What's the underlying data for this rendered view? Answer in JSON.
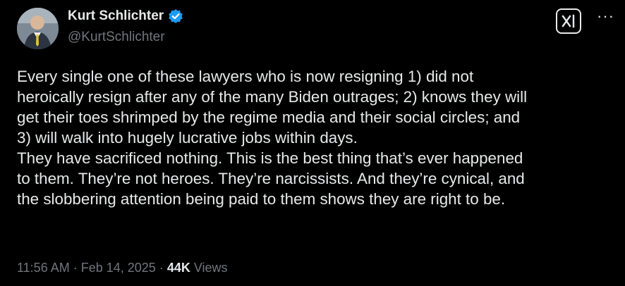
{
  "author": {
    "name": "Kurt Schlichter",
    "handle": "@KurtSchlichter",
    "verified_color": "#1d9bf0"
  },
  "header_actions": {
    "grok_icon": "x-ai-icon",
    "more_label": "···"
  },
  "tweet": {
    "lines": [
      "Every single one of these lawyers who is now resigning 1) did not",
      "heroically resign after any of the many Biden outrages; 2) knows they will",
      "get their toes shrimped by the regime media and their social circles; and",
      "3) will walk into hugely lucrative jobs within days.",
      "They have sacrificed nothing. This is the best thing that’s ever happened",
      "to them. They’re not heroes. They’re narcissists. And they’re cynical, and",
      "the slobbering attention being paid to them shows they are right to be."
    ]
  },
  "meta": {
    "time": "11:56 AM",
    "sep1": " · ",
    "date": "Feb 14, 2025",
    "sep2": " · ",
    "views_count": "44K",
    "views_label": " Views"
  }
}
